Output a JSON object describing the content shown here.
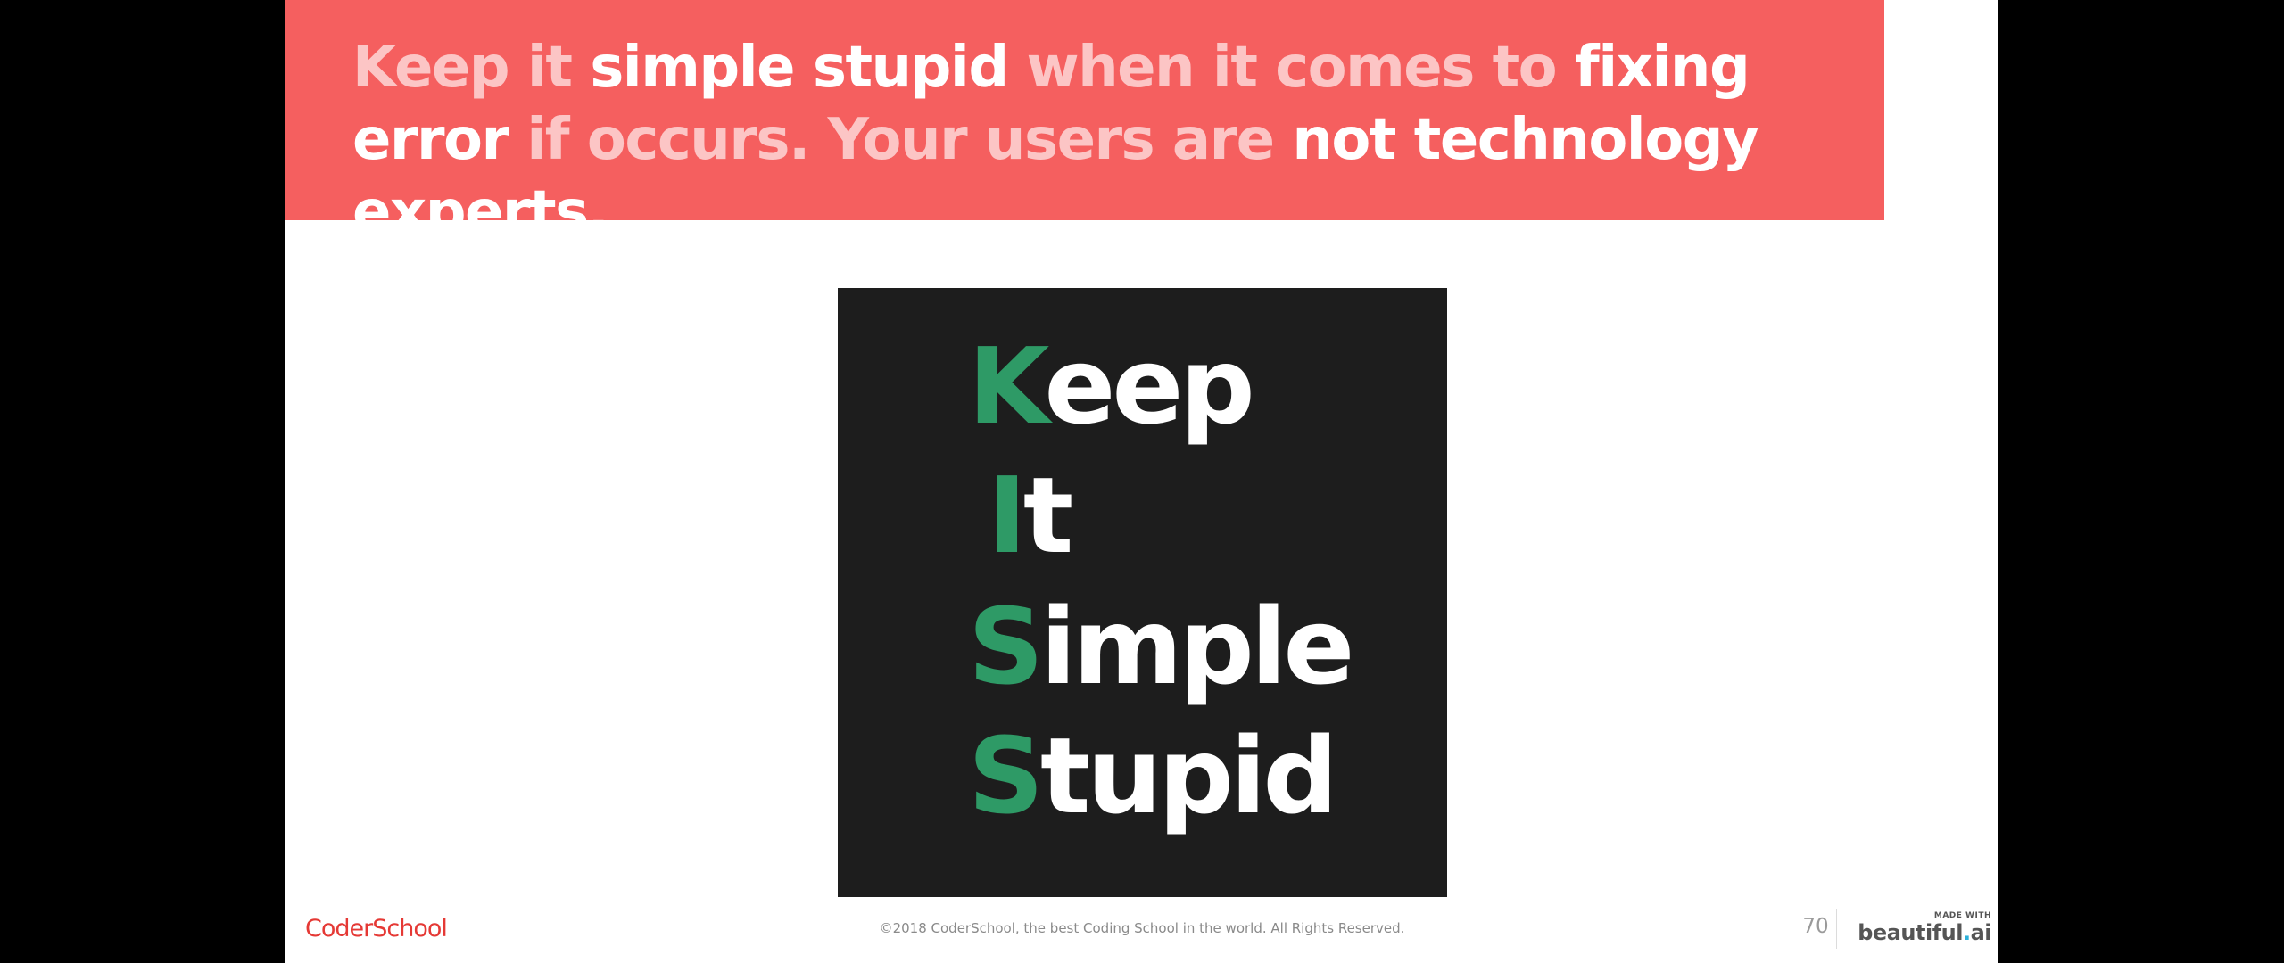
{
  "slide": {
    "headline": {
      "segments": [
        {
          "text": "Keep it ",
          "emphasis": false
        },
        {
          "text": "simple stupid",
          "emphasis": true
        },
        {
          "text": " when it comes to ",
          "emphasis": false
        },
        {
          "text": "fixing error",
          "emphasis": true
        },
        {
          "text": " if occurs. Your users are ",
          "emphasis": false
        },
        {
          "text": "not technology experts",
          "emphasis": true
        },
        {
          "text": ".",
          "emphasis": true
        }
      ]
    },
    "kiss": {
      "words": [
        {
          "initial": "K",
          "rest": "eep"
        },
        {
          "initial": "I",
          "rest": "t"
        },
        {
          "initial": "S",
          "rest": "imple"
        },
        {
          "initial": "S",
          "rest": "tupid"
        }
      ]
    }
  },
  "footer": {
    "logo": "CoderSchool",
    "copyright": "©2018 CoderSchool, the best Coding School in the world. All Rights Reserved.",
    "page_number": "70",
    "made_with_label": "MADE WITH",
    "made_with_brand_1": "beautiful",
    "made_with_brand_dot": ".",
    "made_with_brand_2": "ai"
  },
  "colors": {
    "banner": "#f55f5f",
    "headline_dim": "#fcc5c5",
    "headline_emphasis": "#ffffff",
    "kiss_background": "#1d1d1d",
    "kiss_initial": "#2e9a66",
    "logo": "#e53935",
    "brand_dot": "#2bb0d9"
  }
}
